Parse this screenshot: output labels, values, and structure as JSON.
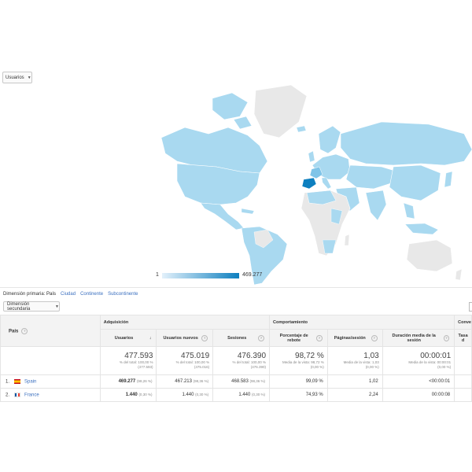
{
  "metric_selector": {
    "value": "Usuarios"
  },
  "legend": {
    "min": "1",
    "max": "469.277"
  },
  "dimension_bar": {
    "label": "Dimensión primaria:",
    "active": "País",
    "links": [
      "Ciudad",
      "Continente",
      "Subcontinente"
    ]
  },
  "secondary_dimension": {
    "label": "Dimensión secundaria"
  },
  "table": {
    "group_headers": {
      "acquisition": "Adquisición",
      "behavior": "Comportamiento",
      "conversions": "Conve"
    },
    "col_country": "País",
    "columns": [
      "Usuarios",
      "Usuarios nuevos",
      "Sesiones",
      "Porcentaje de rebote",
      "Páginas/sesión",
      "Duración media de la sesión",
      "Tasa d"
    ],
    "totals": [
      {
        "value": "477.593",
        "sub1": "% del total: 100,00 %",
        "sub2": "(477.593)"
      },
      {
        "value": "475.019",
        "sub1": "% del total: 100,00 %",
        "sub2": "(475.016)"
      },
      {
        "value": "476.390",
        "sub1": "% del total: 100,00 %",
        "sub2": "(476.390)"
      },
      {
        "value": "98,72 %",
        "sub1": "Media de la vista: 98,72 %",
        "sub2": "(0,00 %)"
      },
      {
        "value": "1,03",
        "sub1": "Media de la vista: 1,03",
        "sub2": "(0,00 %)"
      },
      {
        "value": "00:00:01",
        "sub1": "Media de la vista: 00:00:01",
        "sub2": "(0,00 %)"
      }
    ],
    "rows": [
      {
        "index": "1.",
        "country": "Spain",
        "flag": "es",
        "users": "469.277",
        "users_pct": "(98,26 %)",
        "new_users": "467.213",
        "new_users_pct": "(98,36 %)",
        "sessions": "468.583",
        "sessions_pct": "(98,36 %)",
        "bounce": "99,09 %",
        "pages": "1,02",
        "duration": "<00:00:01"
      },
      {
        "index": "2.",
        "country": "France",
        "flag": "fr",
        "users": "1.440",
        "users_pct": "(0,30 %)",
        "new_users": "1.440",
        "new_users_pct": "(0,30 %)",
        "sessions": "1.440",
        "sessions_pct": "(0,30 %)",
        "bounce": "74,93 %",
        "pages": "2,24",
        "duration": "00:00:08"
      }
    ]
  },
  "colors": {
    "map_light": "#a9d9f0",
    "map_highlight": "#0d7fbf",
    "map_empty": "#e8e8e8",
    "link": "#3a6fbf"
  }
}
